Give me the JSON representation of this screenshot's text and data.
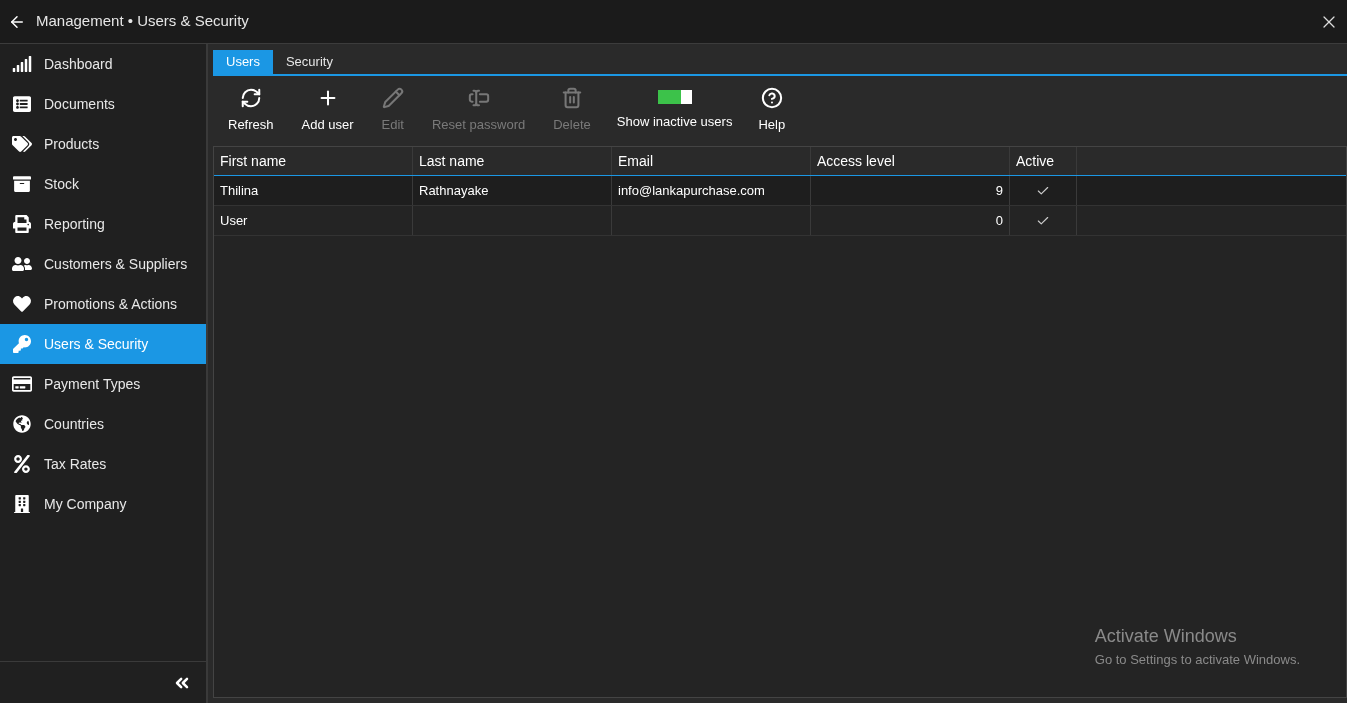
{
  "window": {
    "title": "Management • Users & Security"
  },
  "sidebar": {
    "items": [
      {
        "label": "Dashboard",
        "selected": false
      },
      {
        "label": "Documents",
        "selected": false
      },
      {
        "label": "Products",
        "selected": false
      },
      {
        "label": "Stock",
        "selected": false
      },
      {
        "label": "Reporting",
        "selected": false
      },
      {
        "label": "Customers & Suppliers",
        "selected": false
      },
      {
        "label": "Promotions & Actions",
        "selected": false
      },
      {
        "label": "Users & Security",
        "selected": true
      },
      {
        "label": "Payment Types",
        "selected": false
      },
      {
        "label": "Countries",
        "selected": false
      },
      {
        "label": "Tax Rates",
        "selected": false
      },
      {
        "label": "My Company",
        "selected": false
      }
    ]
  },
  "tabs": [
    {
      "label": "Users",
      "selected": true
    },
    {
      "label": "Security",
      "selected": false
    }
  ],
  "toolbar": [
    {
      "kind": "button",
      "label": "Refresh",
      "disabled": false
    },
    {
      "kind": "button",
      "label": "Add user",
      "disabled": false
    },
    {
      "kind": "button",
      "label": "Edit",
      "disabled": true
    },
    {
      "kind": "button",
      "label": "Reset password",
      "disabled": true
    },
    {
      "kind": "button",
      "label": "Delete",
      "disabled": true
    },
    {
      "kind": "toggle",
      "label": "Show inactive users",
      "on": true
    },
    {
      "kind": "button",
      "label": "Help",
      "disabled": false
    }
  ],
  "table": {
    "columns": [
      "First name",
      "Last name",
      "Email",
      "Access level",
      "Active"
    ],
    "rows": [
      {
        "first_name": "Thilina",
        "last_name": "Rathnayake",
        "email": "info@lankapurchase.com",
        "access_level": "9",
        "active": true
      },
      {
        "first_name": "User",
        "access_level": "0",
        "active": true
      }
    ]
  },
  "os_notice": {
    "title": "Activate Windows",
    "subtitle": "Go to Settings to activate Windows."
  }
}
